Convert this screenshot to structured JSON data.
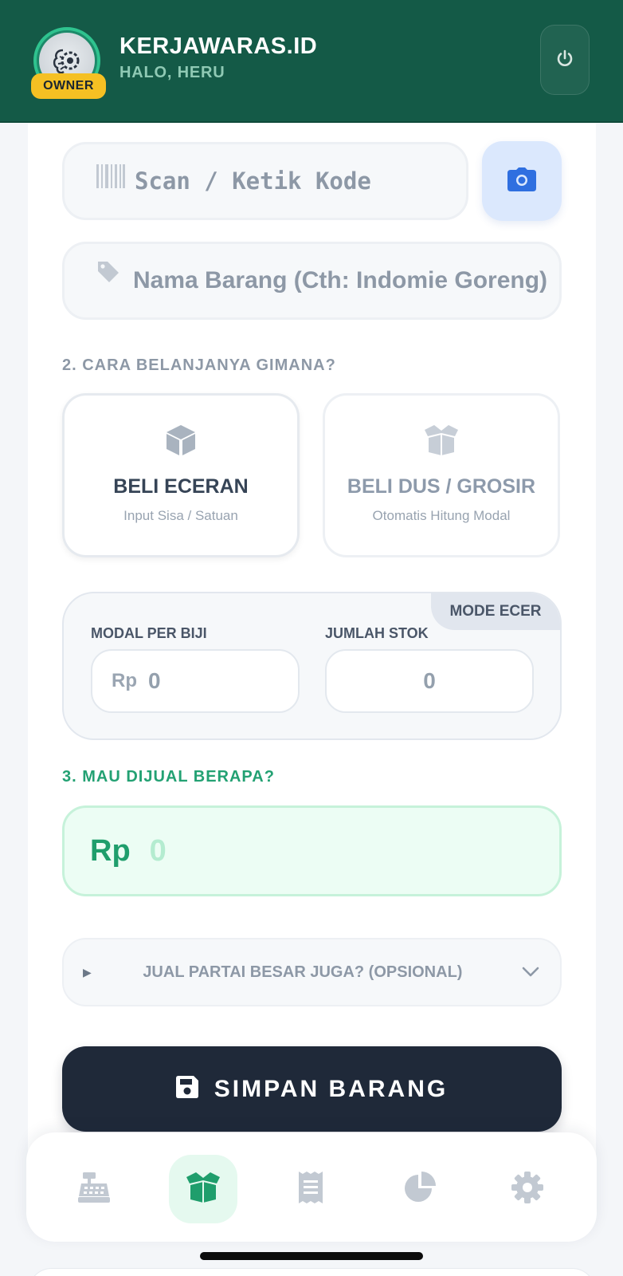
{
  "header": {
    "brand": "KERJAWARAS.ID",
    "greeting": "HALO, HERU",
    "badge": "OWNER",
    "logo_icon": "brain-gear-icon",
    "power_icon": "power-icon",
    "bg_color": "#145a47"
  },
  "form": {
    "scan_placeholder": "Scan / Ketik Kode",
    "name_placeholder": "Nama Barang (Cth: Indomie Goreng)",
    "section2_label": "2. CARA BELANJANYA GIMANA?",
    "options": [
      {
        "title": "BELI ECERAN",
        "subtitle": "Input Sisa / Satuan",
        "icon": "box-icon",
        "selected": true
      },
      {
        "title": "BELI DUS / GROSIR",
        "subtitle": "Otomatis Hitung Modal",
        "icon": "open-box-icon",
        "selected": false
      }
    ],
    "mode_badge": "MODE ECER",
    "modal_label": "MODAL PER BIJI",
    "modal_prefix": "Rp",
    "modal_value": "0",
    "stock_label": "JUMLAH STOK",
    "stock_value": "0",
    "section3_label": "3. MAU DIJUAL BERAPA?",
    "price_prefix": "Rp",
    "price_value": "0",
    "accordion_label": "JUAL PARTAI BESAR JUGA? (OPSIONAL)",
    "save_label": "SIMPAN BARANG"
  },
  "nav": {
    "items": [
      {
        "icon": "cash-register-icon",
        "active": false
      },
      {
        "icon": "box-open-icon",
        "active": true
      },
      {
        "icon": "receipt-icon",
        "active": false
      },
      {
        "icon": "pie-chart-icon",
        "active": false
      },
      {
        "icon": "gear-icon",
        "active": false
      }
    ]
  },
  "colors": {
    "accent_green": "#23a173",
    "dark_button": "#1f2939",
    "badge_yellow": "#f5c023",
    "camera_blue": "#2f6fe0"
  }
}
